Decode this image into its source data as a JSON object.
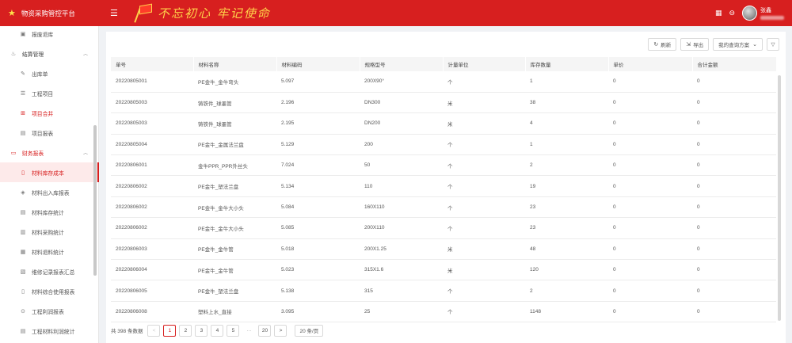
{
  "header": {
    "app_title": "物资采购管控平台",
    "slogan": "不忘初心 牢记使命",
    "user_name": "张鑫"
  },
  "sidebar": {
    "items": [
      {
        "label": "报废退库",
        "icon": "document-icon"
      },
      {
        "label": "结算管理",
        "icon": "settlement-icon",
        "group": true
      },
      {
        "label": "出库单",
        "icon": "outbound-icon"
      },
      {
        "label": "工程项目",
        "icon": "list-icon"
      },
      {
        "label": "项目合并",
        "icon": "merge-icon"
      },
      {
        "label": "项目报表",
        "icon": "report-icon"
      },
      {
        "label": "财务报表",
        "icon": "finance-icon",
        "group": true
      },
      {
        "label": "材料库存成本",
        "icon": "cost-icon"
      },
      {
        "label": "材料出入库报表",
        "icon": "inout-icon"
      },
      {
        "label": "材料库存统计",
        "icon": "stock-icon"
      },
      {
        "label": "材料采购统计",
        "icon": "purchase-icon"
      },
      {
        "label": "材料退料统计",
        "icon": "return-icon"
      },
      {
        "label": "维修记录报表汇总",
        "icon": "repair-icon"
      },
      {
        "label": "材料综合使用报表",
        "icon": "usage-icon"
      },
      {
        "label": "工程利润报表",
        "icon": "profit-icon"
      },
      {
        "label": "工程材料利润统计",
        "icon": "material-profit-icon"
      }
    ]
  },
  "toolbar": {
    "refresh_label": "刷新",
    "export_label": "导出",
    "scheme_label": "我的查询方案"
  },
  "table": {
    "columns": [
      "单号",
      "材料名称",
      "材料编码",
      "规格型号",
      "计量单位",
      "库存数量",
      "单价",
      "合计金额"
    ],
    "rows": [
      [
        "20220805001",
        "PE金牛_金牛弯头",
        "5.097",
        "200X90°",
        "个",
        "1",
        "0",
        "0"
      ],
      [
        "20220805003",
        "铸铁件_球墨管",
        "2.196",
        "DN300",
        "米",
        "38",
        "0",
        "0"
      ],
      [
        "20220805003",
        "铸铁件_球墨管",
        "2.195",
        "DN200",
        "米",
        "4",
        "0",
        "0"
      ],
      [
        "20220805004",
        "PE金牛_金属法兰盘",
        "5.129",
        "200",
        "个",
        "1",
        "0",
        "0"
      ],
      [
        "20220806001",
        "金牛PPR_PPR外丝头",
        "7.024",
        "50",
        "个",
        "2",
        "0",
        "0"
      ],
      [
        "20220806002",
        "PE金牛_塑法兰盘",
        "5.134",
        "110",
        "个",
        "19",
        "0",
        "0"
      ],
      [
        "20220806002",
        "PE金牛_金牛大小头",
        "5.084",
        "160X110",
        "个",
        "23",
        "0",
        "0"
      ],
      [
        "20220806002",
        "PE金牛_金牛大小头",
        "5.085",
        "200X110",
        "个",
        "23",
        "0",
        "0"
      ],
      [
        "20220806003",
        "PE金牛_金牛管",
        "5.018",
        "200X1.25",
        "米",
        "48",
        "0",
        "0"
      ],
      [
        "20220806004",
        "PE金牛_金牛管",
        "5.023",
        "315X1.6",
        "米",
        "120",
        "0",
        "0"
      ],
      [
        "20220806005",
        "PE金牛_塑法兰盘",
        "5.138",
        "315",
        "个",
        "2",
        "0",
        "0"
      ],
      [
        "20220806008",
        "塑料上水_直接",
        "3.095",
        "25",
        "个",
        "1148",
        "0",
        "0"
      ]
    ]
  },
  "pagination": {
    "total_text": "共 398 条数据",
    "prev": "<",
    "next": ">",
    "pages": [
      "1",
      "2",
      "3",
      "4",
      "5"
    ],
    "ellipsis": "···",
    "last_page": "20",
    "current_page": "1",
    "page_size": "20 条/页"
  }
}
